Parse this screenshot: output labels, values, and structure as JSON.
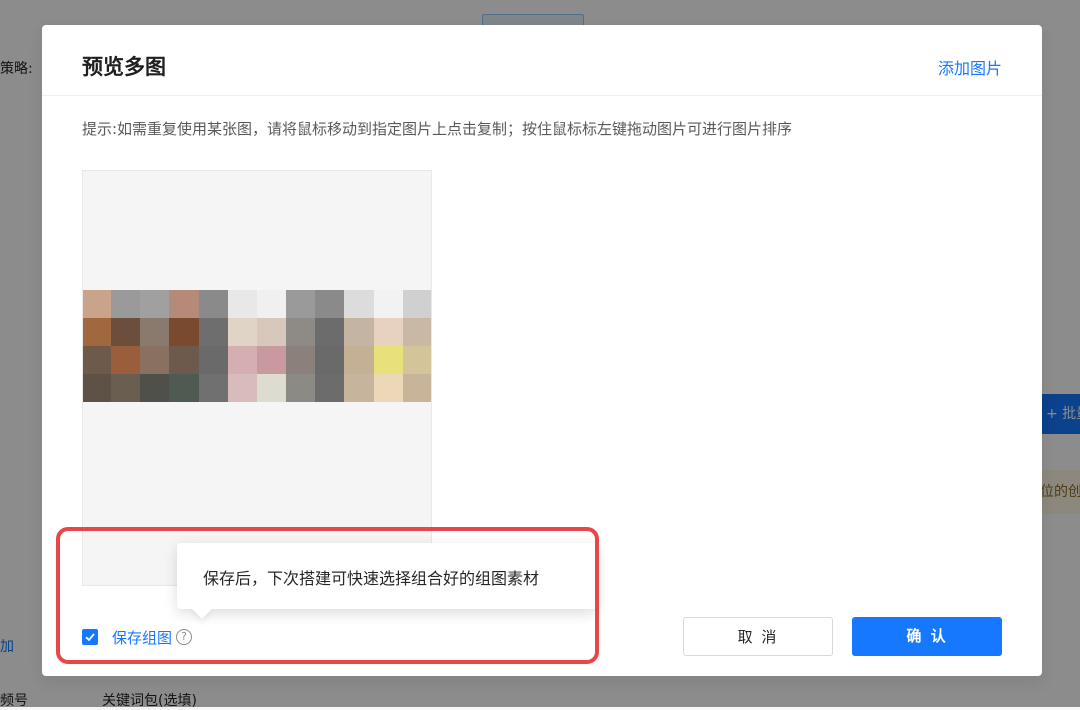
{
  "background": {
    "strategy_label": "策略:",
    "add_link": "加",
    "serial_label": "频号",
    "keyword_pack_label": "关键词包(选填)",
    "batch_button": "+ 批量",
    "tag_text": "位的创"
  },
  "modal": {
    "title": "预览多图",
    "add_image_link": "添加图片",
    "hint": "提示:如需重复使用某张图，请将鼠标移动到指定图片上点击复制；按住鼠标标左键拖动图片可进行图片排序",
    "tooltip": "保存后，下次搭建可快速选择组合好的组图素材",
    "save_group_label": "保存组图",
    "save_group_checked": true,
    "help_icon_glyph": "?",
    "cancel_button": "取 消",
    "confirm_button": "确 认"
  },
  "colors": {
    "primary": "#1677ff",
    "highlight": "#e8464b"
  },
  "icons": [
    "checkbox-checked-icon",
    "question-circle-icon"
  ]
}
